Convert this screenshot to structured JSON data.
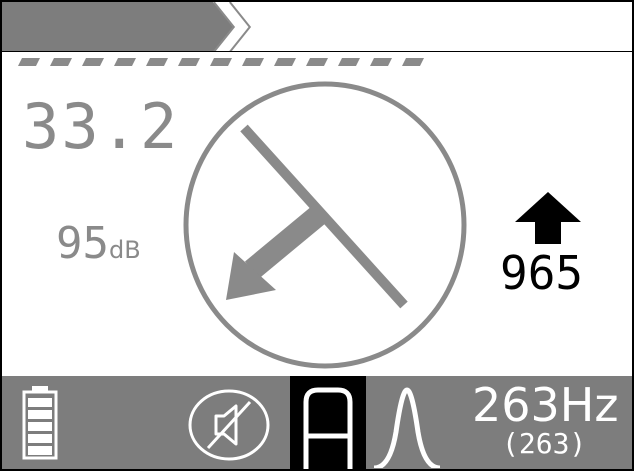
{
  "depth": "33.2",
  "signal": {
    "value": "95",
    "unit": "dB"
  },
  "progress_fraction": 0.36,
  "guide": {
    "direction": "up",
    "value": "965"
  },
  "status_bar": {
    "frequency": "263Hz",
    "frequency_sub": "(263)",
    "icons": [
      "battery-icon",
      "speaker-muted-icon",
      "locate-mode-icon",
      "peak-response-icon"
    ]
  },
  "colors": {
    "gray": "#8a8a8a",
    "status_bar": "#7d7d7d",
    "text_dark": "#000000",
    "text_light": "#ffffff"
  }
}
